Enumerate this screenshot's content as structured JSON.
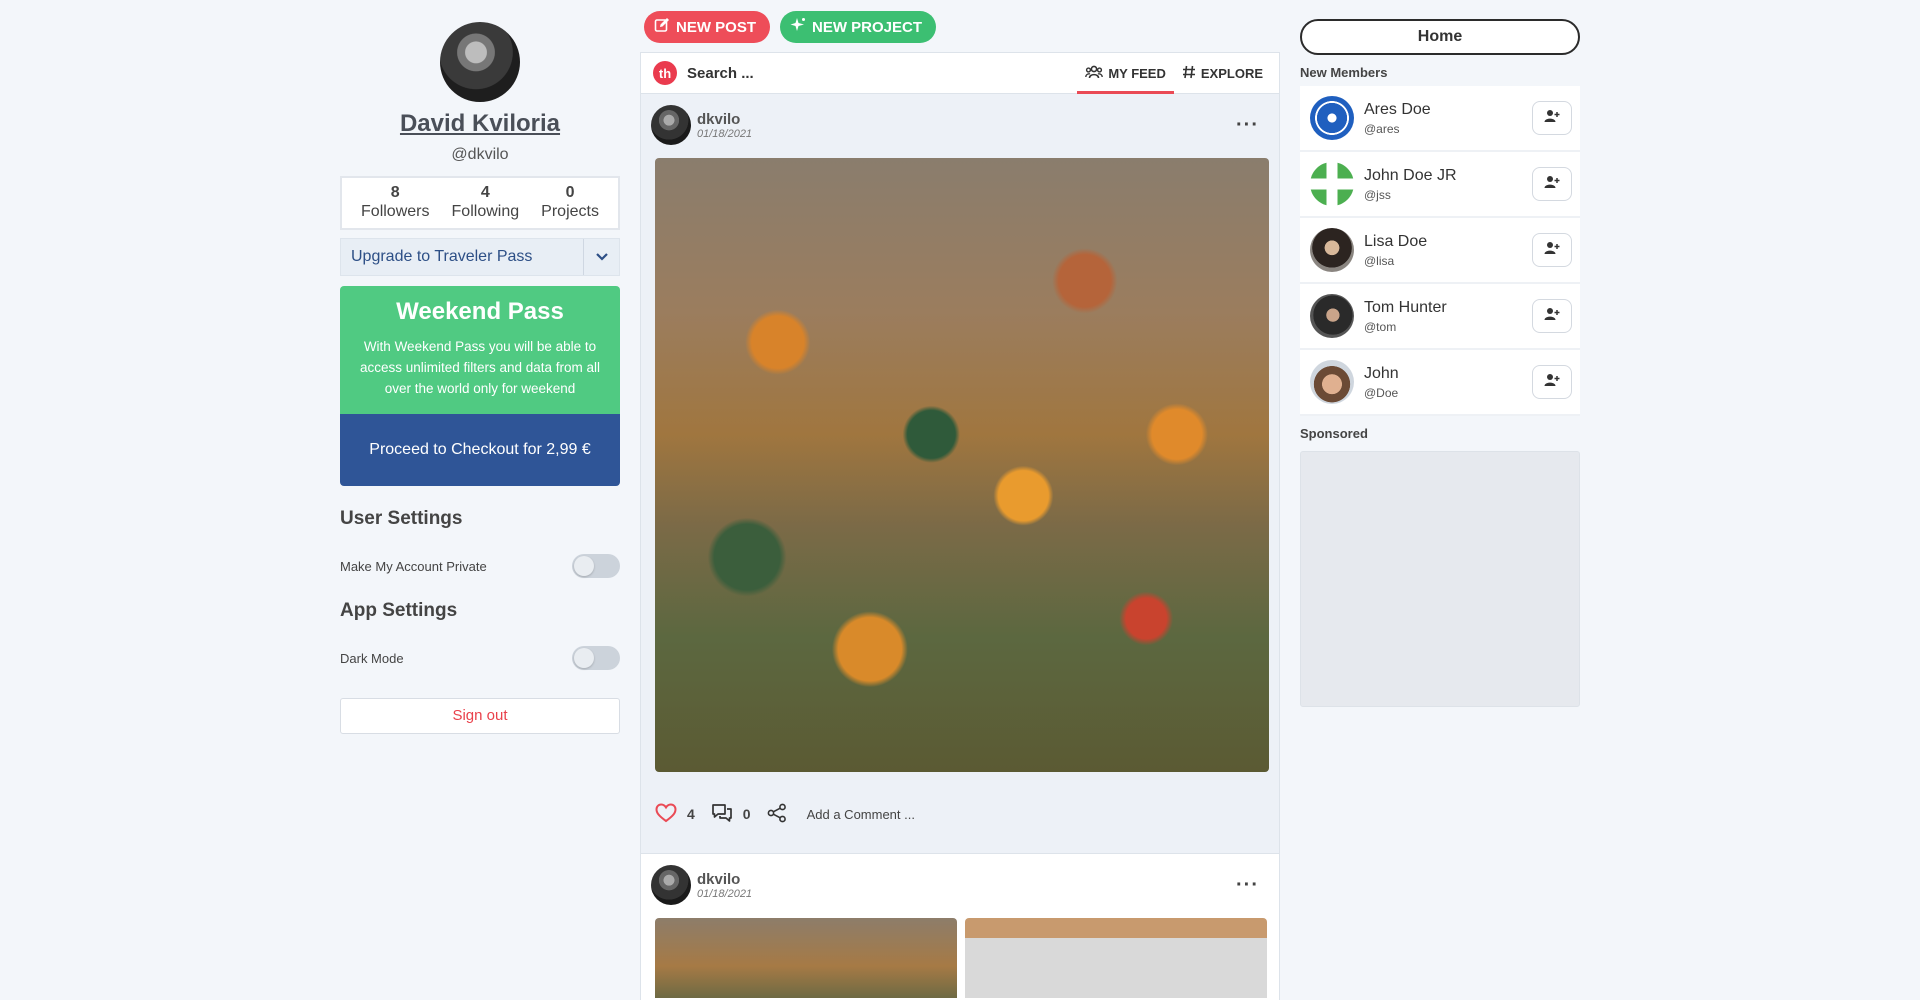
{
  "profile": {
    "name": "David Kviloria",
    "handle": "@dkvilo",
    "stats": [
      {
        "value": "8",
        "label": "Followers"
      },
      {
        "value": "4",
        "label": "Following"
      },
      {
        "value": "0",
        "label": "Projects"
      }
    ]
  },
  "upgrade": {
    "label": "Upgrade to Traveler Pass",
    "icon": "chevron-down-icon"
  },
  "pass": {
    "title": "Weekend Pass",
    "description": "With Weekend Pass you will be able to access unlimited filters and data from all over the world only for weekend",
    "checkout_label": "Proceed to Checkout for 2,99 €"
  },
  "user_settings": {
    "title": "User Settings",
    "private_label": "Make My Account Private"
  },
  "app_settings": {
    "title": "App Settings",
    "dark_mode_label": "Dark Mode"
  },
  "sign_out_label": "Sign out",
  "topbar": {
    "new_post_label": "NEW POST",
    "new_project_label": "NEW PROJECT"
  },
  "feedbar": {
    "logo_text": "th",
    "search_placeholder": "Search ...",
    "tabs": [
      {
        "label": "MY FEED",
        "icon": "users-icon",
        "active": true
      },
      {
        "label": "EXPLORE",
        "icon": "hash-icon",
        "active": false
      }
    ]
  },
  "posts": [
    {
      "user": "dkvilo",
      "date": "01/18/2021",
      "likes": "4",
      "comments": "0",
      "comment_placeholder": "Add a Comment ..."
    },
    {
      "user": "dkvilo",
      "date": "01/18/2021"
    }
  ],
  "right": {
    "home_label": "Home",
    "new_members_title": "New Members",
    "members": [
      {
        "name": "Ares Doe",
        "handle": "@ares"
      },
      {
        "name": "John Doe JR",
        "handle": "@jss"
      },
      {
        "name": "Lisa Doe",
        "handle": "@lisa"
      },
      {
        "name": "Tom Hunter",
        "handle": "@tom"
      },
      {
        "name": "John",
        "handle": "@Doe"
      }
    ],
    "sponsored_title": "Sponsored"
  },
  "colors": {
    "accent_red": "#ee4d59",
    "accent_green": "#3cbf72",
    "pass_green": "#50ca82",
    "pass_blue": "#2f5597"
  }
}
